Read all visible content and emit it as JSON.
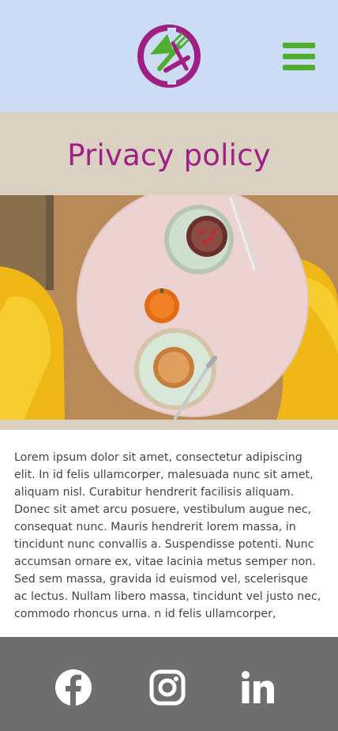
{
  "header": {
    "logo_icon": "plate-fork-knife-logo-icon",
    "menu_icon": "hamburger-menu-icon",
    "colors": {
      "background": "#cddcf5",
      "logo_magenta": "#a01f84",
      "logo_green": "#4fae2f",
      "menu_green": "#4fae2f"
    }
  },
  "title_band": {
    "title": "Privacy policy",
    "colors": {
      "background": "#dbd1c3",
      "title": "#a01f84"
    }
  },
  "hero": {
    "image": "top-down-photo-round-pink-table-two-plates-pastries-pumpkin-yellow-chairs"
  },
  "content": {
    "text": "Lorem ipsum dolor sit amet, consectetur adipiscing elit. In id felis ullamcorper, malesuada nunc sit amet, aliquam nisl. Curabitur hendrerit facilisis aliquam. Donec sit amet arcu posuere, vestibulum augue nec, consequat nunc. Mauris hendrerit lorem massa, in tincidunt nunc convallis a. Suspendisse potenti. Nunc accumsan ornare ex, vitae lacinia metus semper non. Sed sem massa, gravida id euismod vel, scelerisque ac lectus. Nullam libero massa, tincidunt vel justo nec, commodo rhoncus urna. n id felis ullamcorper,"
  },
  "footer": {
    "social": [
      {
        "icon": "facebook-icon"
      },
      {
        "icon": "instagram-icon"
      },
      {
        "icon": "linkedin-icon"
      }
    ],
    "colors": {
      "background": "#6e6e6e",
      "icons": "#ffffff"
    }
  }
}
